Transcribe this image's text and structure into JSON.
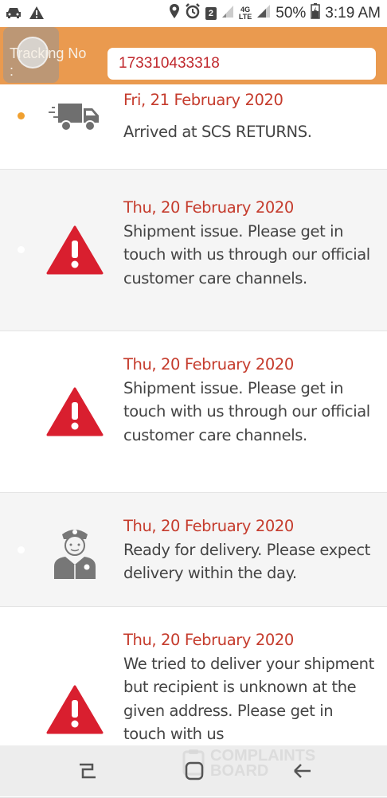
{
  "status_bar": {
    "battery": "50%",
    "time": "3:19 AM",
    "badge": "2",
    "network": "4G",
    "network_sub": "LTE",
    "icons": [
      "car-icon",
      "warning-icon",
      "location-icon",
      "alarm-icon",
      "signal-icon",
      "battery-icon"
    ]
  },
  "header": {
    "tracking_label": "Tracking No :",
    "tracking_number": "173310433318",
    "bg_color": "#ea9a4f"
  },
  "events": [
    {
      "date": "Fri, 21 February 2020",
      "description": "Arrived at SCS RETURNS.",
      "icon": "delivery-truck-icon",
      "active": true
    },
    {
      "date": "Thu, 20 February 2020",
      "description": "Shipment issue. Please get in touch with us through our official customer care channels.",
      "icon": "warning-triangle-icon",
      "active": false
    },
    {
      "date": "Thu, 20 February 2020",
      "description": "Shipment issue. Please get in touch with us through our official customer care channels.",
      "icon": "warning-triangle-icon",
      "active": false
    },
    {
      "date": "Thu, 20 February 2020",
      "description": "Ready for delivery. Please expect delivery within the day.",
      "icon": "courier-icon",
      "active": false
    },
    {
      "date": "Thu, 20 February 2020",
      "description": "We tried to deliver your shipment but recipient is unknown at the given address. Please get in touch with us",
      "icon": "warning-triangle-icon",
      "active": false
    }
  ],
  "watermark": {
    "line1": "COMPLAINTS",
    "line2": "BOARD"
  },
  "colors": {
    "date_red": "#c53b2c",
    "active_dot": "#f0a030",
    "warning_red": "#d91f2f"
  }
}
